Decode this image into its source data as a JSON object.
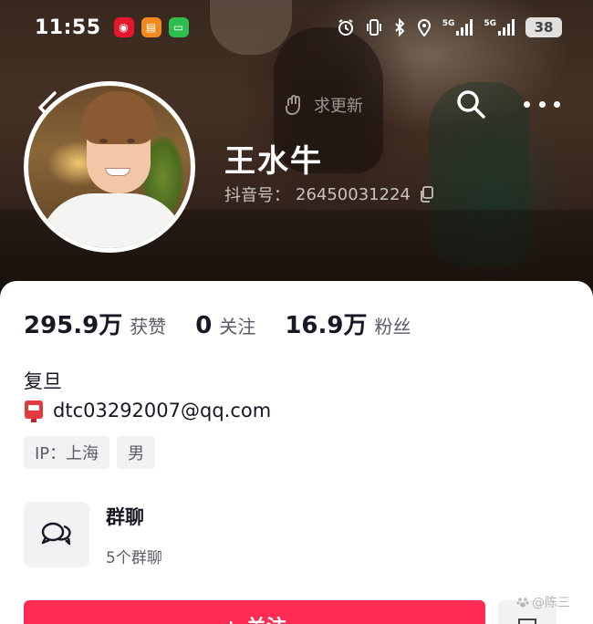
{
  "status_bar": {
    "time": "11:55",
    "apps": [
      {
        "name": "weibo-app-icon",
        "color": "#e6162d",
        "glyph": "◉"
      },
      {
        "name": "mail-app-icon",
        "color": "#f08a1c",
        "glyph": "▤"
      },
      {
        "name": "messages-app-icon",
        "color": "#2dbe4f",
        "glyph": "▭"
      }
    ],
    "network_1": "5G",
    "network_2": "5G",
    "battery": "38"
  },
  "header": {
    "hint_text": "求更新",
    "name": "王水牛",
    "douyin_id_label": "抖音号：",
    "douyin_id_value": "26450031224"
  },
  "stats": [
    {
      "value": "295.9万",
      "label": "获赞"
    },
    {
      "value": "0",
      "label": "关注"
    },
    {
      "value": "16.9万",
      "label": "粉丝"
    }
  ],
  "bio": {
    "school": "复旦",
    "email": "dtc03292007@qq.com"
  },
  "tags": [
    "IP：上海",
    "男"
  ],
  "group_chat": {
    "title": "群聊",
    "subtitle": "5个群聊"
  },
  "actions": {
    "follow_label": "+ 关注"
  },
  "watermark": "@陈三",
  "colors": {
    "accent": "#fe2c55",
    "text_primary": "#161823",
    "text_secondary": "#5a5c66",
    "tag_bg": "#f2f2f4"
  }
}
